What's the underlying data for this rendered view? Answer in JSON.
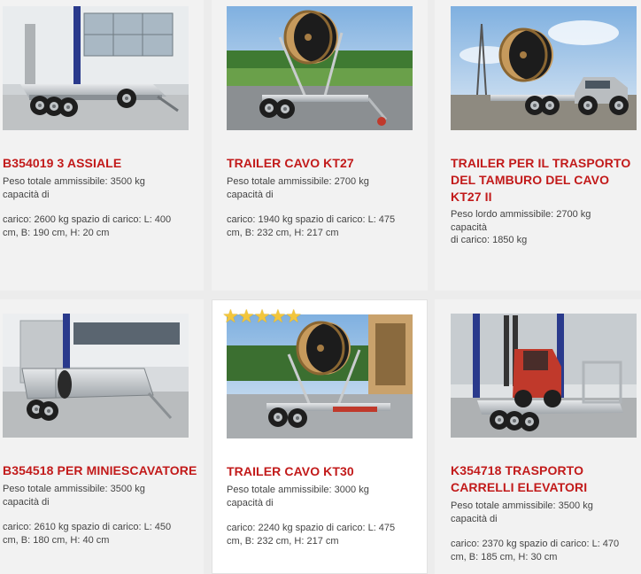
{
  "products": [
    {
      "code": "B354019",
      "title": "3 ASSIALE",
      "image": "triple-axle-trailer-photo",
      "line1": "Peso totale ammissibile: 3500 kg",
      "line2": "capacità di",
      "line3": "carico: 2600 kg spazio di carico: L: 400",
      "line4": "cm, B: 190 cm, H: 20 cm"
    },
    {
      "code": "TRAILER",
      "title": "CAVO KT27",
      "image": "cable-drum-trailer-photo",
      "line1": "Peso totale ammissibile: 2700 kg",
      "line2": "capacità di",
      "line3": "carico: 1940 kg spazio di carico: L: 475",
      "line4": "cm, B: 232 cm, H: 217 cm"
    },
    {
      "code": "TRAILER",
      "title": "PER IL TRASPORTO DEL TAMBURO DEL CAVO KT27 II",
      "image": "cable-drum-trailer-with-car-photo",
      "line1": "Peso lordo ammissibile: 2700 kg",
      "line2": "capacità",
      "line3": "di carico: 1850 kg",
      "line4": ""
    },
    {
      "code": "B354518",
      "title": "PER MINIESCAVATORE",
      "image": "mini-excavator-trailer-photo",
      "line1": "Peso totale ammissibile: 3500 kg",
      "line2": "capacità di",
      "line3": "carico: 2610 kg spazio di carico: L: 450",
      "line4": "cm, B: 180 cm, H: 40 cm"
    },
    {
      "code": "TRAILER",
      "title": "CAVO KT30",
      "image": "cable-drum-trailer-kt30-photo",
      "rating": 5,
      "line1": "Peso totale ammissibile: 3000 kg",
      "line2": "capacità di",
      "line3": "carico: 2240 kg spazio di carico: L: 475",
      "line4": "cm, B: 232 cm, H: 217 cm"
    },
    {
      "code": "K354718",
      "title": "TRASPORTO CARRELLI ELEVATORI",
      "image": "forklift-trailer-photo",
      "line1": "Peso totale ammissibile: 3500 kg",
      "line2": "capacità di",
      "line3": "carico: 2370 kg spazio di carico: L: 470",
      "line4": "cm, B: 185 cm, H: 30 cm"
    }
  ],
  "colors": {
    "title": "#c21a1a",
    "text": "#444444",
    "star": "#f3c63b",
    "card": "#f2f2f2"
  }
}
